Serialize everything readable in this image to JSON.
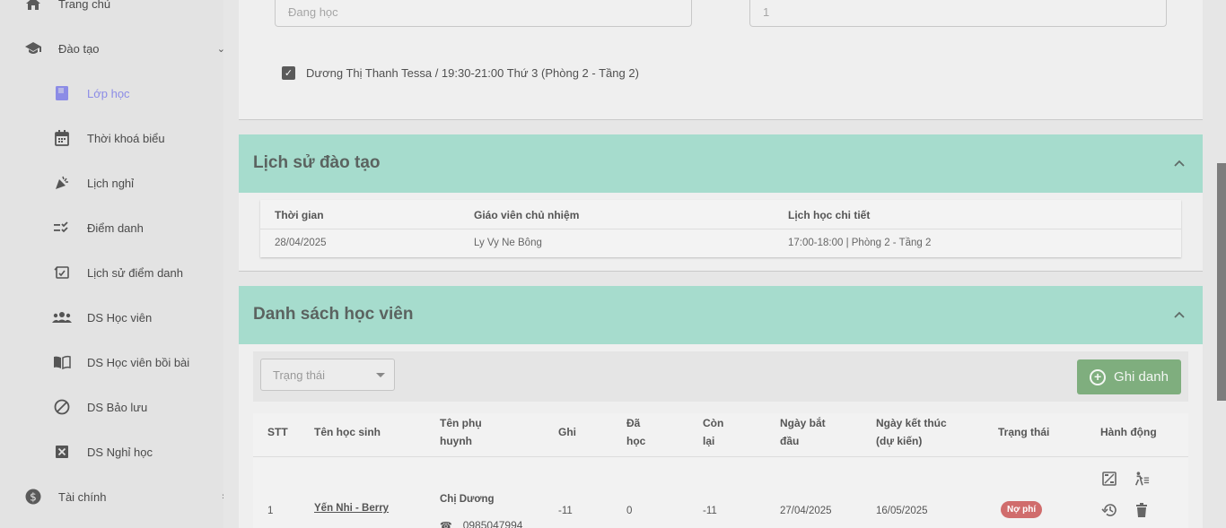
{
  "sidebar": {
    "home": "Trang chủ",
    "training": "Đào tạo",
    "items": [
      {
        "label": "Lớp học",
        "icon": "book-icon"
      },
      {
        "label": "Thời khoá biểu",
        "icon": "calendar-icon"
      },
      {
        "label": "Lịch nghỉ",
        "icon": "party-icon"
      },
      {
        "label": "Điểm danh",
        "icon": "checklist-icon"
      },
      {
        "label": "Lịch sử điểm danh",
        "icon": "history-checklist-icon"
      },
      {
        "label": "DS Học viên",
        "icon": "group-icon"
      },
      {
        "label": "DS Học viên bồi bài",
        "icon": "open-book-icon"
      },
      {
        "label": "DS Bảo lưu",
        "icon": "block-icon"
      },
      {
        "label": "DS Nghỉ học",
        "icon": "cancel-box-icon"
      }
    ],
    "finance": "Tài chính"
  },
  "form": {
    "status_placeholder": "Đang học",
    "number_placeholder": "1",
    "schedule_option": "Dương Thị Thanh Tessa / 19:30-21:00 Thứ 3 (Phòng 2 - Tầng 2)"
  },
  "history": {
    "title": "Lịch sử đào tạo",
    "headers": [
      "Thời gian",
      "Giáo viên chủ nhiệm",
      "Lịch học chi tiết"
    ],
    "row": [
      "28/04/2025",
      "Ly Vy Ne Bông",
      "17:00-18:00 | Phòng 2 - Tầng 2"
    ]
  },
  "students": {
    "title": "Danh sách học viên",
    "filter_placeholder": "Trạng thái",
    "enroll_label": "Ghi danh",
    "headers": {
      "stt": "STT",
      "name": "Tên học sinh",
      "parent_l1": "Tên phụ",
      "parent_l2": "huynh",
      "note": "Ghi",
      "done_l1": "Đã",
      "done_l2": "học",
      "left_l1": "Còn",
      "left_l2": "lại",
      "start_l1": "Ngày bắt",
      "start_l2": "đầu",
      "end_l1": "Ngày kết thúc",
      "end_l2": "(dự kiến)",
      "status": "Trạng thái",
      "actions": "Hành động"
    },
    "row": {
      "stt": "1",
      "name": "Yến Nhi - Berry",
      "parent": "Chị Dương",
      "phone": "0985047994",
      "note": "-11",
      "done": "0",
      "left": "-11",
      "start": "27/04/2025",
      "end": "16/05/2025",
      "status": "Nợ phí"
    }
  },
  "colors": {
    "section_header": "#a6dccd",
    "active_nav": "#8c8ce6",
    "enroll_button": "#7fae7e",
    "debt_badge": "#d06c6c"
  }
}
